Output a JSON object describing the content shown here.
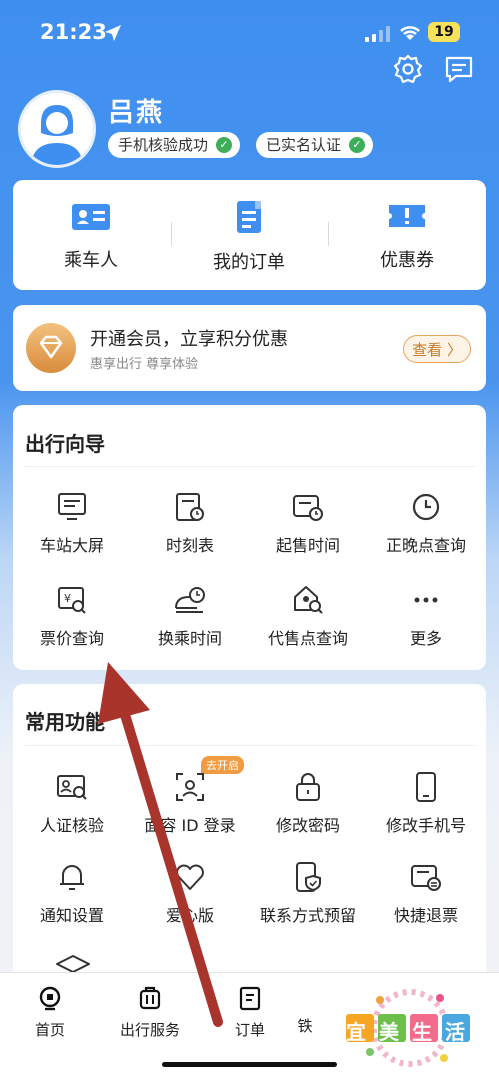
{
  "status_bar": {
    "time": "21:23",
    "battery": "19"
  },
  "profile": {
    "name": "吕燕",
    "badges": [
      "手机核验成功",
      "已实名认证"
    ]
  },
  "quick_menu": [
    {
      "label": "乘车人",
      "icon": "passenger-card-icon"
    },
    {
      "label": "我的订单",
      "icon": "order-list-icon"
    },
    {
      "label": "优惠券",
      "icon": "coupon-icon"
    }
  ],
  "membership": {
    "title": "开通会员，立享积分优惠",
    "subtitle": "惠享出行 尊享体验",
    "button": "查看 〉"
  },
  "travel_guide": {
    "title": "出行向导",
    "items": [
      {
        "label": "车站大屏",
        "icon": "station-screen-icon"
      },
      {
        "label": "时刻表",
        "icon": "timetable-icon"
      },
      {
        "label": "起售时间",
        "icon": "sale-time-icon"
      },
      {
        "label": "正晚点查询",
        "icon": "clock-icon"
      },
      {
        "label": "票价查询",
        "icon": "fare-search-icon"
      },
      {
        "label": "换乘时间",
        "icon": "transfer-time-icon"
      },
      {
        "label": "代售点查询",
        "icon": "agency-search-icon"
      },
      {
        "label": "更多",
        "icon": "more-icon"
      }
    ]
  },
  "common_functions": {
    "title": "常用功能",
    "tag": "去开启",
    "items": [
      {
        "label": "人证核验",
        "icon": "id-verify-icon"
      },
      {
        "label": "面容 ID 登录",
        "icon": "face-id-icon"
      },
      {
        "label": "修改密码",
        "icon": "lock-icon"
      },
      {
        "label": "修改手机号",
        "icon": "phone-icon"
      },
      {
        "label": "通知设置",
        "icon": "bell-icon"
      },
      {
        "label": "爱心版",
        "icon": "heart-icon"
      },
      {
        "label": "联系方式预留",
        "icon": "contact-shield-icon"
      },
      {
        "label": "快捷退票",
        "icon": "refund-ticket-icon"
      }
    ]
  },
  "tab_bar": [
    {
      "label": "首页",
      "icon": "train-home-icon"
    },
    {
      "label": "出行服务",
      "icon": "luggage-icon"
    },
    {
      "label": "订单",
      "icon": "order-icon"
    },
    {
      "label": "铁",
      "icon": "partial-icon"
    }
  ],
  "watermark": {
    "text": "宜美生活"
  },
  "colors": {
    "brand_blue": "#3f8ff0",
    "success_green": "#3fae5a",
    "vip_orange": "#e8a55f",
    "annotation_arrow": "#a8342c"
  }
}
